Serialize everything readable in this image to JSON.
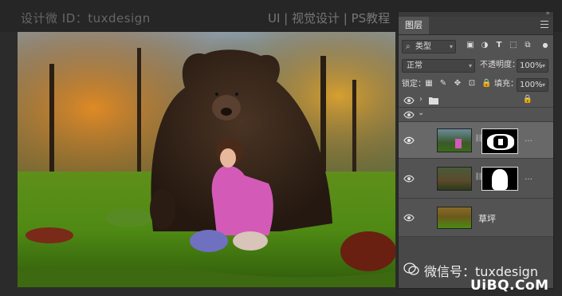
{
  "watermark": {
    "left": "设计微 ID：tuxdesign",
    "right": "UI | 视觉设计 | PS教程"
  },
  "panel": {
    "tab": "图层",
    "filter": {
      "label": "类型"
    },
    "blend_mode": "正常",
    "opacity": {
      "label": "不透明度：",
      "value": "100%"
    },
    "lock": {
      "label": "锁定："
    },
    "fill": {
      "label": "填充：",
      "value": "100%"
    },
    "layers": [
      {
        "type": "group-collapsed",
        "name": "",
        "locked": true
      },
      {
        "type": "group-expanded",
        "name": ""
      },
      {
        "type": "layer-with-mask",
        "name": "",
        "selected": true
      },
      {
        "type": "layer-with-mask",
        "name": ""
      },
      {
        "type": "layer",
        "name": "草坪"
      }
    ],
    "more": "…"
  },
  "overlay": {
    "wechat": "微信号：tuxdesign",
    "site": "UiBQ.CoM"
  },
  "colors": {
    "panel_bg": "#535353",
    "selected_row": "#686868",
    "accent_green": "#5a9e1c"
  }
}
